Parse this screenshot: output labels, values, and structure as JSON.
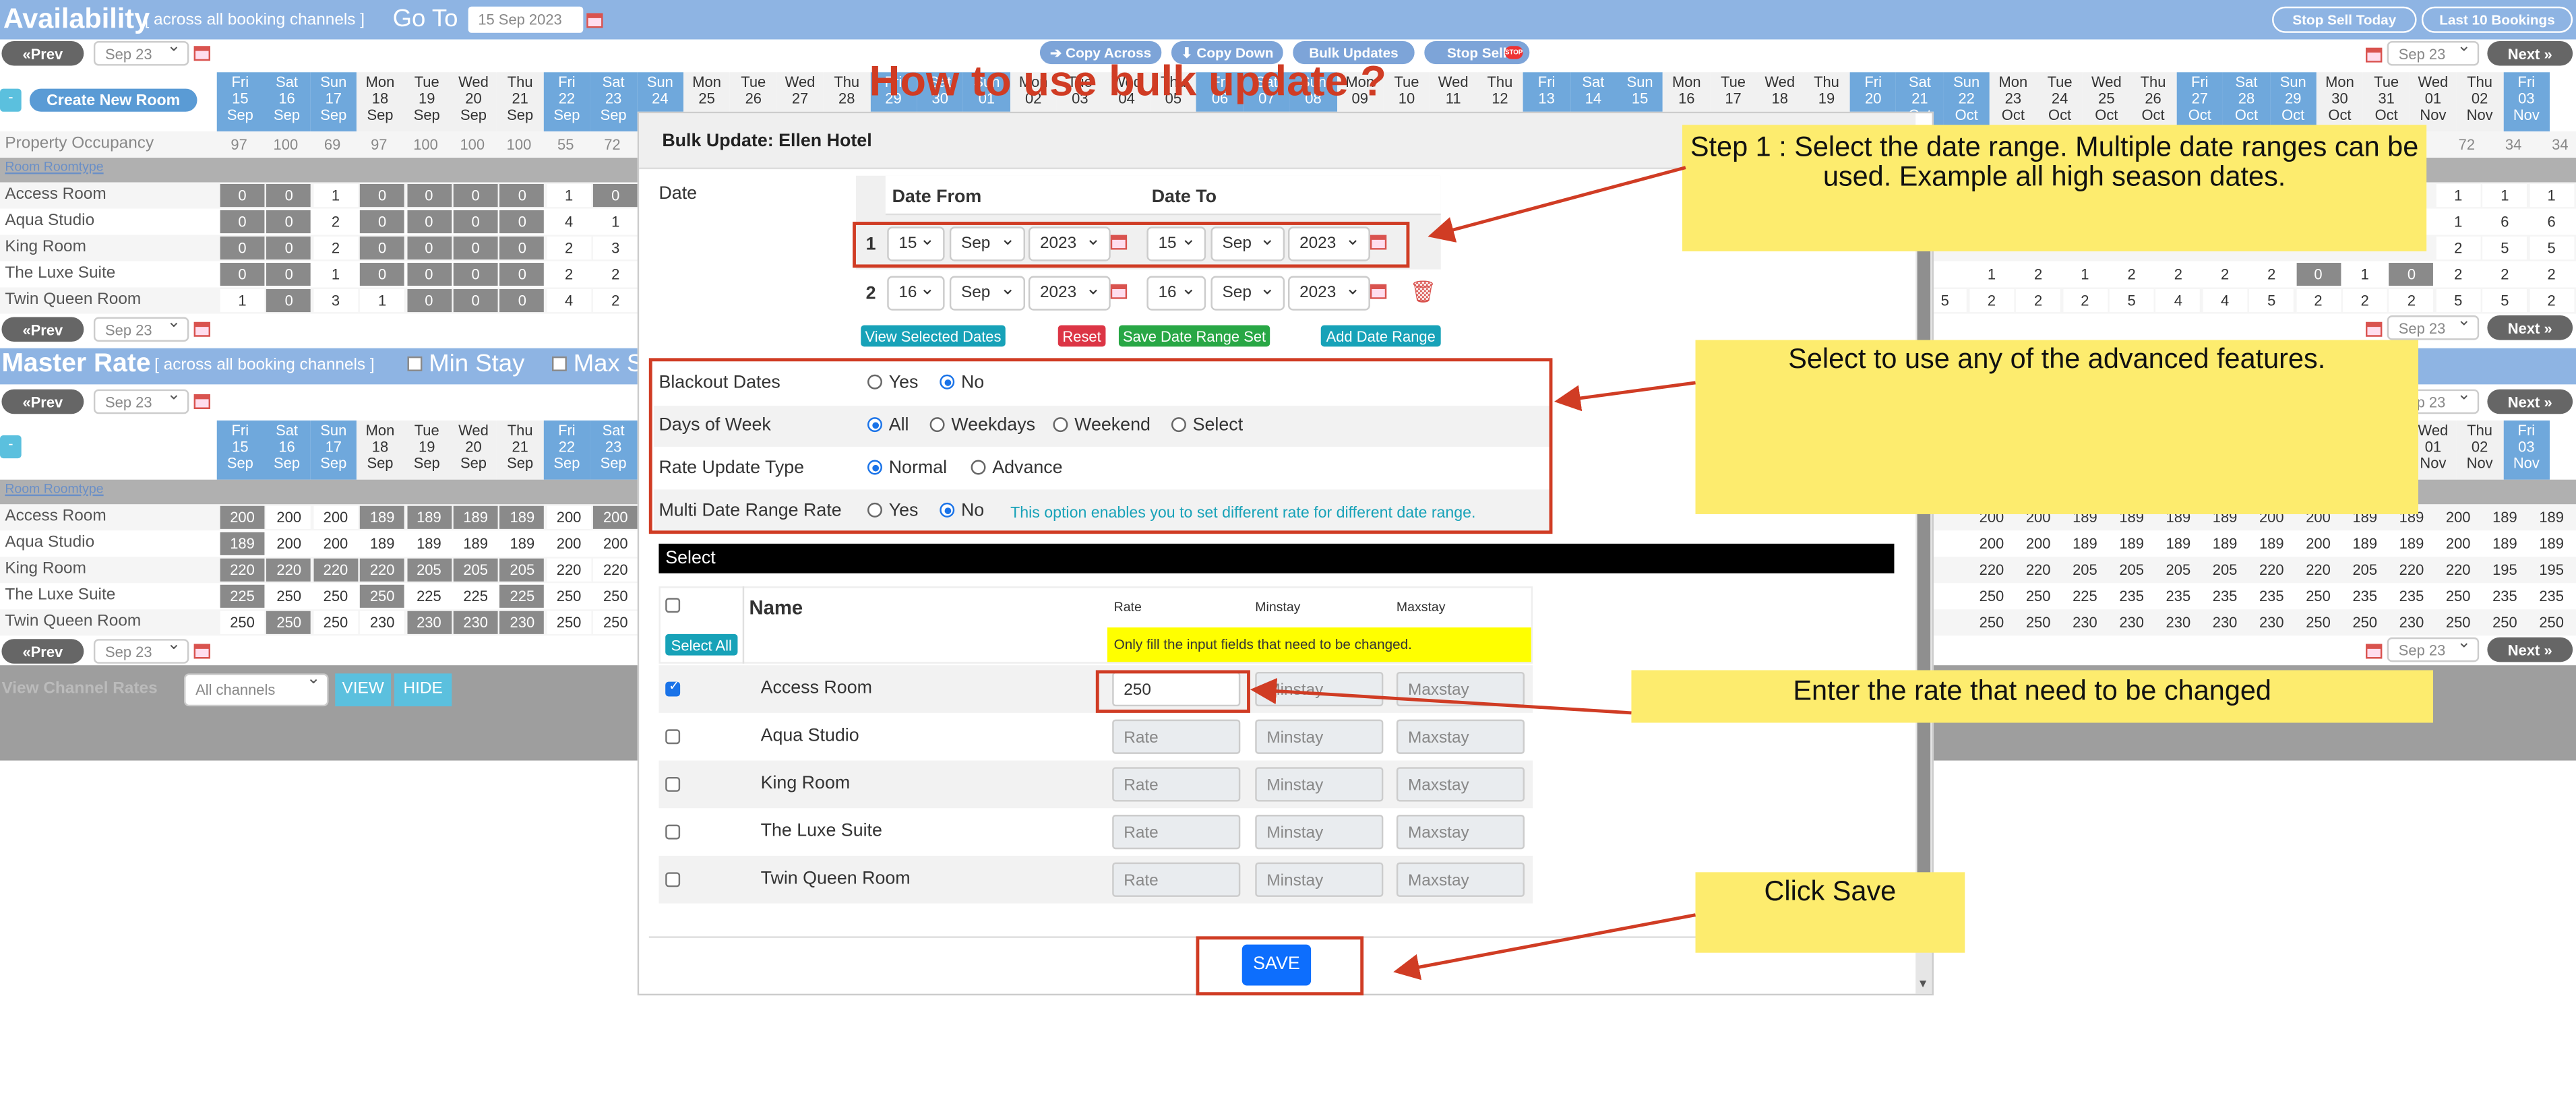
{
  "topbar": {
    "title": "Availability",
    "subtitle": "[ across all booking channels ]",
    "goto_label": "Go To",
    "goto_value": "15 Sep 2023",
    "buttons": [
      "Copy Across",
      "Copy Down",
      "Bulk Updates",
      "Stop Sell"
    ],
    "stop_badge": "STOP",
    "stop_sell_today": "Stop Sell Today",
    "last_bookings": "Last 10 Bookings"
  },
  "nav": {
    "prev": "Prev",
    "next": "Next",
    "month": "Sep 23"
  },
  "availability": {
    "create_room": "Create New Room",
    "minus": "-",
    "left_days": [
      {
        "dow": "Fri",
        "d": "15",
        "m": "Sep",
        "we": true
      },
      {
        "dow": "Sat",
        "d": "16",
        "m": "Sep",
        "we": true
      },
      {
        "dow": "Sun",
        "d": "17",
        "m": "Sep",
        "we": true
      },
      {
        "dow": "Mon",
        "d": "18",
        "m": "Sep",
        "we": false
      },
      {
        "dow": "Tue",
        "d": "19",
        "m": "Sep",
        "we": false
      },
      {
        "dow": "Wed",
        "d": "20",
        "m": "Sep",
        "we": false
      },
      {
        "dow": "Thu",
        "d": "21",
        "m": "Sep",
        "we": false
      },
      {
        "dow": "Fri",
        "d": "22",
        "m": "Sep",
        "we": true
      },
      {
        "dow": "Sat",
        "d": "23",
        "m": "Sep",
        "we": true
      },
      {
        "dow": "Sun",
        "d": "24",
        "m": "",
        "we": true
      },
      {
        "dow": "Mon",
        "d": "25",
        "m": "",
        "we": false
      },
      {
        "dow": "Tue",
        "d": "26",
        "m": "",
        "we": false
      },
      {
        "dow": "Wed",
        "d": "27",
        "m": "",
        "we": false
      },
      {
        "dow": "Thu",
        "d": "28",
        "m": "",
        "we": false
      },
      {
        "dow": "Fri",
        "d": "29",
        "m": "",
        "we": true
      },
      {
        "dow": "Sat",
        "d": "30",
        "m": "",
        "we": true
      },
      {
        "dow": "Sun",
        "d": "01",
        "m": "",
        "we": true
      },
      {
        "dow": "Mon",
        "d": "02",
        "m": "",
        "we": false
      },
      {
        "dow": "Tue",
        "d": "03",
        "m": "",
        "we": false
      },
      {
        "dow": "Wed",
        "d": "04",
        "m": "",
        "we": false
      },
      {
        "dow": "Thu",
        "d": "05",
        "m": "",
        "we": false
      },
      {
        "dow": "Fri",
        "d": "06",
        "m": "",
        "we": true
      },
      {
        "dow": "Sat",
        "d": "07",
        "m": "",
        "we": true
      },
      {
        "dow": "Sun",
        "d": "08",
        "m": "",
        "we": true
      },
      {
        "dow": "Mon",
        "d": "09",
        "m": "",
        "we": false
      },
      {
        "dow": "Tue",
        "d": "10",
        "m": "",
        "we": false
      },
      {
        "dow": "Wed",
        "d": "11",
        "m": "",
        "we": false
      },
      {
        "dow": "Thu",
        "d": "12",
        "m": "",
        "we": false
      },
      {
        "dow": "Fri",
        "d": "13",
        "m": "",
        "we": true
      },
      {
        "dow": "Sat",
        "d": "14",
        "m": "",
        "we": true
      },
      {
        "dow": "Sun",
        "d": "15",
        "m": "",
        "we": true
      },
      {
        "dow": "Mon",
        "d": "16",
        "m": "",
        "we": false
      },
      {
        "dow": "Tue",
        "d": "17",
        "m": "",
        "we": false
      },
      {
        "dow": "Wed",
        "d": "18",
        "m": "",
        "we": false
      },
      {
        "dow": "Thu",
        "d": "19",
        "m": "",
        "we": false
      },
      {
        "dow": "Fri",
        "d": "20",
        "m": "",
        "we": true
      },
      {
        "dow": "Sat",
        "d": "21",
        "m": "Oct",
        "we": true
      },
      {
        "dow": "Sun",
        "d": "22",
        "m": "Oct",
        "we": true
      },
      {
        "dow": "Mon",
        "d": "23",
        "m": "Oct",
        "we": false
      },
      {
        "dow": "Tue",
        "d": "24",
        "m": "Oct",
        "we": false
      },
      {
        "dow": "Wed",
        "d": "25",
        "m": "Oct",
        "we": false
      },
      {
        "dow": "Thu",
        "d": "26",
        "m": "Oct",
        "we": false
      },
      {
        "dow": "Fri",
        "d": "27",
        "m": "Oct",
        "we": true
      },
      {
        "dow": "Sat",
        "d": "28",
        "m": "Oct",
        "we": true
      },
      {
        "dow": "Sun",
        "d": "29",
        "m": "Oct",
        "we": true
      },
      {
        "dow": "Mon",
        "d": "30",
        "m": "Oct",
        "we": false
      },
      {
        "dow": "Tue",
        "d": "31",
        "m": "Oct",
        "we": false
      },
      {
        "dow": "Wed",
        "d": "01",
        "m": "Nov",
        "we": false
      },
      {
        "dow": "Thu",
        "d": "02",
        "m": "Nov",
        "we": false
      },
      {
        "dow": "Fri",
        "d": "03",
        "m": "Nov",
        "we": true
      }
    ],
    "occupancy_label": "Property Occupancy",
    "occupancy_left": [
      "97",
      "100",
      "69",
      "97",
      "100",
      "100",
      "100",
      "55",
      "72"
    ],
    "occupancy_right": [
      "72",
      "34",
      "34"
    ],
    "rooms_header": "Room Roomtype",
    "rooms": [
      {
        "name": "Access Room",
        "left": [
          [
            "0",
            "d"
          ],
          [
            "0",
            "d"
          ],
          [
            "1",
            "l"
          ],
          [
            "0",
            "d"
          ],
          [
            "0",
            "d"
          ],
          [
            "0",
            "d"
          ],
          [
            "0",
            "d"
          ],
          [
            "1",
            "l"
          ],
          [
            "0",
            "d"
          ]
        ],
        "right": [
          [
            "1",
            "l"
          ],
          [
            "1",
            "l"
          ],
          [
            "1",
            "l"
          ]
        ]
      },
      {
        "name": "Aqua Studio",
        "left": [
          [
            "0",
            "d"
          ],
          [
            "0",
            "d"
          ],
          [
            "2",
            "l"
          ],
          [
            "0",
            "d"
          ],
          [
            "0",
            "d"
          ],
          [
            "0",
            "d"
          ],
          [
            "0",
            "d"
          ],
          [
            "4",
            "l"
          ],
          [
            "1",
            "l"
          ]
        ],
        "right": [
          [
            "1",
            "l"
          ],
          [
            "6",
            "l"
          ],
          [
            "6",
            "l"
          ]
        ]
      },
      {
        "name": "King Room",
        "left": [
          [
            "0",
            "d"
          ],
          [
            "0",
            "d"
          ],
          [
            "2",
            "l"
          ],
          [
            "0",
            "d"
          ],
          [
            "0",
            "d"
          ],
          [
            "0",
            "d"
          ],
          [
            "0",
            "d"
          ],
          [
            "2",
            "l"
          ],
          [
            "3",
            "l"
          ]
        ],
        "right": [
          [
            "2",
            "l"
          ],
          [
            "5",
            "l"
          ],
          [
            "5",
            "l"
          ]
        ]
      },
      {
        "name": "The Luxe Suite",
        "left": [
          [
            "0",
            "d"
          ],
          [
            "0",
            "d"
          ],
          [
            "1",
            "l"
          ],
          [
            "0",
            "d"
          ],
          [
            "0",
            "d"
          ],
          [
            "0",
            "d"
          ],
          [
            "0",
            "d"
          ],
          [
            "2",
            "l"
          ],
          [
            "2",
            "l"
          ]
        ],
        "right": [
          [
            "1",
            "l"
          ],
          [
            "2",
            "l"
          ],
          [
            "1",
            "l"
          ],
          [
            "2",
            "l"
          ],
          [
            "2",
            "l"
          ],
          [
            "2",
            "l"
          ],
          [
            "2",
            "l"
          ],
          [
            "0",
            "d"
          ],
          [
            "1",
            "l"
          ],
          [
            "0",
            "d"
          ],
          [
            "2",
            "l"
          ],
          [
            "2",
            "l"
          ],
          [
            "2",
            "l"
          ]
        ]
      },
      {
        "name": "Twin Queen Room",
        "left": [
          [
            "1",
            "l"
          ],
          [
            "0",
            "d"
          ],
          [
            "3",
            "l"
          ],
          [
            "1",
            "l"
          ],
          [
            "0",
            "d"
          ],
          [
            "0",
            "d"
          ],
          [
            "0",
            "d"
          ],
          [
            "4",
            "l"
          ],
          [
            "2",
            "l"
          ]
        ],
        "right": [
          [
            "5",
            "l"
          ],
          [
            "5",
            "l"
          ],
          [
            "2",
            "l"
          ],
          [
            "2",
            "l"
          ],
          [
            "2",
            "l"
          ],
          [
            "5",
            "l"
          ],
          [
            "4",
            "l"
          ],
          [
            "4",
            "l"
          ],
          [
            "5",
            "l"
          ],
          [
            "2",
            "l"
          ],
          [
            "2",
            "l"
          ],
          [
            "2",
            "l"
          ],
          [
            "5",
            "l"
          ],
          [
            "5",
            "l"
          ],
          [
            "2",
            "l"
          ]
        ]
      }
    ]
  },
  "master_rate": {
    "title": "Master Rate",
    "subtitle": "[ across all booking channels ]",
    "min_stay": "Min Stay",
    "max_stay": "Max S",
    "rooms": [
      {
        "name": "Access Room",
        "left": [
          [
            "200",
            "d"
          ],
          [
            "200",
            "l"
          ],
          [
            "200",
            "l"
          ],
          [
            "189",
            "d"
          ],
          [
            "189",
            "d"
          ],
          [
            "189",
            "d"
          ],
          [
            "189",
            "d"
          ],
          [
            "200",
            "l"
          ],
          [
            "200",
            "d"
          ]
        ],
        "right": [
          "200",
          "200",
          "189",
          "189",
          "189",
          "189",
          "200",
          "200",
          "189",
          "189",
          "200",
          "189",
          "189"
        ]
      },
      {
        "name": "Aqua Studio",
        "left": [
          [
            "189",
            "d"
          ],
          [
            "200",
            "l"
          ],
          [
            "200",
            "l"
          ],
          [
            "189",
            "l"
          ],
          [
            "189",
            "l"
          ],
          [
            "189",
            "l"
          ],
          [
            "189",
            "l"
          ],
          [
            "200",
            "l"
          ],
          [
            "200",
            "l"
          ]
        ],
        "right": [
          "200",
          "200",
          "189",
          "189",
          "189",
          "189",
          "189",
          "200",
          "189",
          "189",
          "200",
          "189",
          "189"
        ]
      },
      {
        "name": "King Room",
        "left": [
          [
            "220",
            "d"
          ],
          [
            "220",
            "d"
          ],
          [
            "220",
            "d"
          ],
          [
            "220",
            "d"
          ],
          [
            "205",
            "d"
          ],
          [
            "205",
            "d"
          ],
          [
            "205",
            "d"
          ],
          [
            "220",
            "l"
          ],
          [
            "220",
            "l"
          ]
        ],
        "right": [
          "220",
          "220",
          "205",
          "205",
          "205",
          "205",
          "220",
          "220",
          "205",
          "220",
          "220",
          "195",
          "195"
        ]
      },
      {
        "name": "The Luxe Suite",
        "left": [
          [
            "225",
            "d"
          ],
          [
            "250",
            "l"
          ],
          [
            "250",
            "l"
          ],
          [
            "250",
            "d"
          ],
          [
            "225",
            "l"
          ],
          [
            "225",
            "l"
          ],
          [
            "225",
            "d"
          ],
          [
            "250",
            "l"
          ],
          [
            "250",
            "l"
          ]
        ],
        "right": [
          "250",
          "250",
          "225",
          "235",
          "235",
          "235",
          "235",
          "250",
          "235",
          "235",
          "250",
          "235",
          "235"
        ]
      },
      {
        "name": "Twin Queen Room",
        "left": [
          [
            "250",
            "l"
          ],
          [
            "250",
            "d"
          ],
          [
            "250",
            "l"
          ],
          [
            "230",
            "l"
          ],
          [
            "230",
            "d"
          ],
          [
            "230",
            "d"
          ],
          [
            "230",
            "d"
          ],
          [
            "250",
            "l"
          ],
          [
            "250",
            "l"
          ]
        ],
        "right": [
          "250",
          "250",
          "230",
          "230",
          "230",
          "230",
          "230",
          "250",
          "250",
          "230",
          "250",
          "250",
          "250"
        ]
      }
    ],
    "view_channel": "View Channel Rates",
    "channels": "All channels",
    "view": "VIEW",
    "hide": "HIDE"
  },
  "modal": {
    "header": "Bulk Update: Ellen Hotel",
    "date_label": "Date",
    "date_from": "Date From",
    "date_to": "Date To",
    "ranges": [
      {
        "n": "1",
        "fd": "15",
        "fm": "Sep",
        "fy": "2023",
        "td": "15",
        "tm": "Sep",
        "ty": "2023"
      },
      {
        "n": "2",
        "fd": "16",
        "fm": "Sep",
        "fy": "2023",
        "td": "16",
        "tm": "Sep",
        "ty": "2023"
      }
    ],
    "btn_view": "View Selected Dates",
    "btn_reset": "Reset",
    "btn_save_range": "Save Date Range Set",
    "btn_add_range": "Add Date Range",
    "blackout": {
      "label": "Blackout Dates",
      "yes": "Yes",
      "no": "No"
    },
    "dow": {
      "label": "Days of Week",
      "all": "All",
      "weekdays": "Weekdays",
      "weekend": "Weekend",
      "select": "Select"
    },
    "rate_type": {
      "label": "Rate Update Type",
      "normal": "Normal",
      "advance": "Advance"
    },
    "multi": {
      "label": "Multi Date Range Rate",
      "yes": "Yes",
      "no": "No",
      "hint": "This option enables you to set different rate for different date range."
    },
    "select_bar": "Select",
    "table": {
      "name": "Name",
      "rate": "Rate",
      "minstay": "Minstay",
      "maxstay": "Maxstay",
      "select_all": "Select All",
      "hint": "Only fill the input fields that need to be changed.",
      "rows": [
        {
          "name": "Access Room",
          "checked": true,
          "rate": "250"
        },
        {
          "name": "Aqua Studio",
          "checked": false,
          "rate": ""
        },
        {
          "name": "King Room",
          "checked": false,
          "rate": ""
        },
        {
          "name": "The Luxe Suite",
          "checked": false,
          "rate": ""
        },
        {
          "name": "Twin Queen Room",
          "checked": false,
          "rate": ""
        }
      ]
    },
    "save": "SAVE"
  },
  "annotations": {
    "title": "How to use bulk update ?",
    "step1": "Step 1 : Select the date range. Multiple date ranges can be used. Example all high season dates.",
    "advanced": "Select to use any of the advanced features.",
    "enter_rate": "Enter the rate that need to be changed",
    "click_save": "Click Save"
  },
  "colors": {
    "accent_red": "#d03c24",
    "note_yellow": "#fdec6e",
    "header_blue": "#8eb4e3",
    "save_blue": "#0d6efd"
  }
}
